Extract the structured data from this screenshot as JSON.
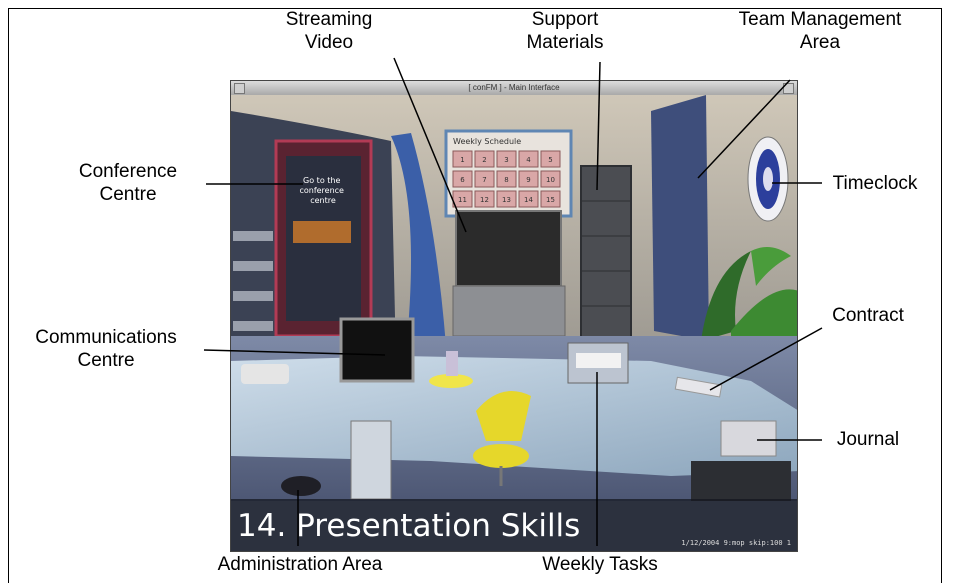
{
  "window": {
    "title": "[ conFM ] - Main Interface",
    "caption": "14. Presentation Skills",
    "status": "1/12/2004 9:mop skip:100 1"
  },
  "scene": {
    "board_text": "Go to the conference centre",
    "schedule_title": "Weekly Schedule",
    "schedule_days": [
      "1",
      "2",
      "3",
      "4",
      "5",
      "6",
      "7",
      "8",
      "9",
      "10",
      "11",
      "12",
      "13",
      "14",
      "15"
    ]
  },
  "callouts": {
    "streaming_video": [
      "Streaming",
      "Video"
    ],
    "support_materials": [
      "Support",
      "Materials"
    ],
    "team_management": [
      "Team Management",
      "Area"
    ],
    "conference_centre": [
      "Conference",
      "Centre"
    ],
    "timeclock": [
      "Timeclock"
    ],
    "communications_centre": [
      "Communications",
      "Centre"
    ],
    "contract": [
      "Contract"
    ],
    "journal": [
      "Journal"
    ],
    "administration_area": [
      "Administration Area"
    ],
    "weekly_tasks": [
      "Weekly Tasks"
    ]
  }
}
